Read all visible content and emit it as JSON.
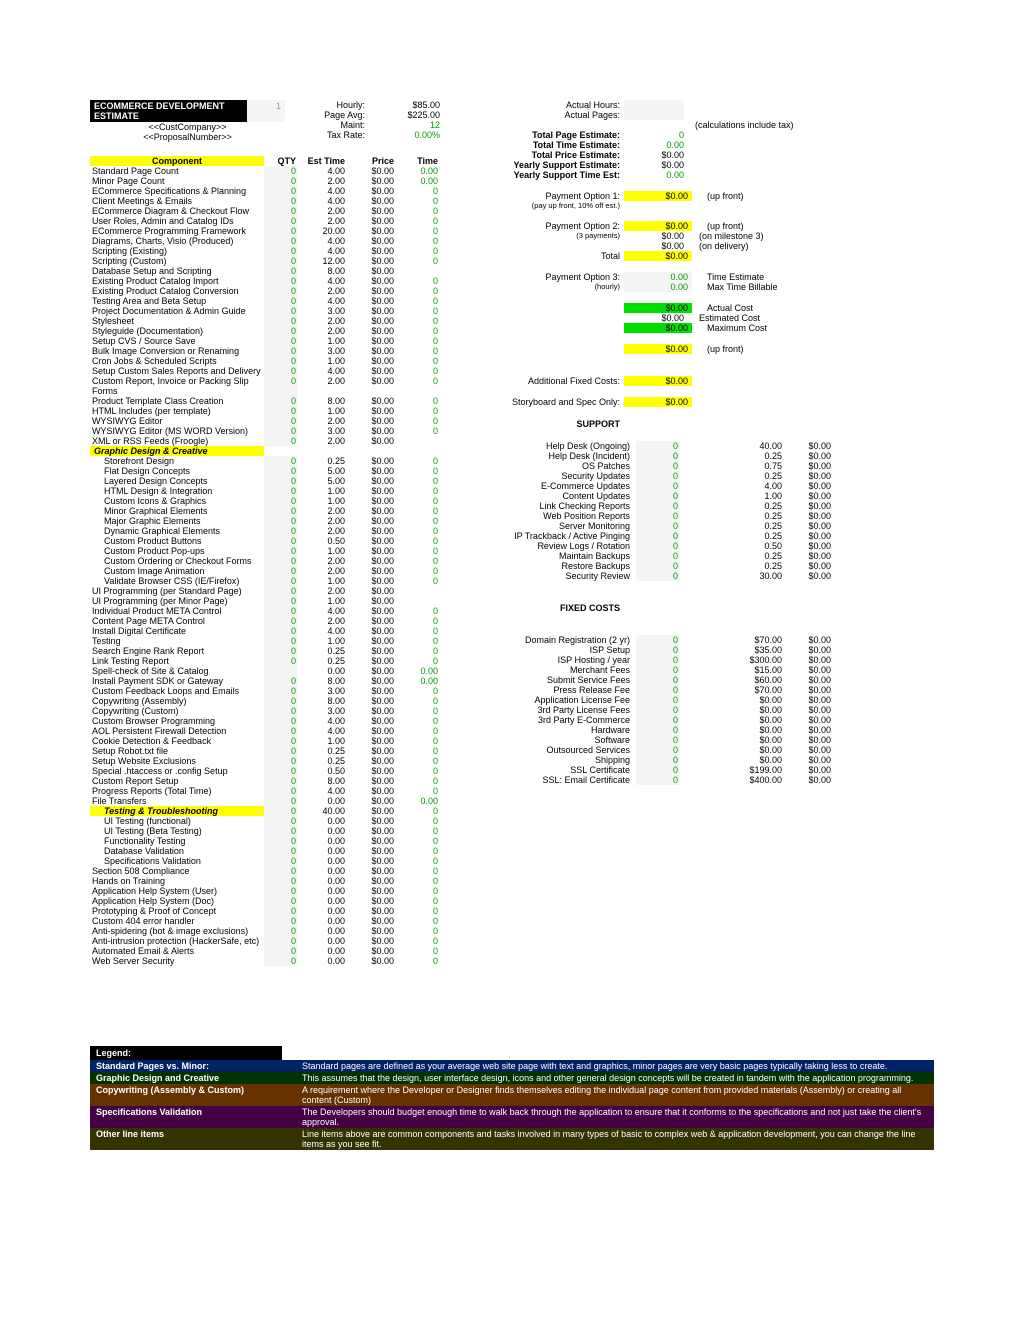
{
  "chart_data": {
    "type": "table",
    "title": "ECOMMERCE DEVELOPMENT ESTIMATE",
    "columns": [
      "Component",
      "QTY",
      "Est Time",
      "Price",
      "Time"
    ]
  },
  "title": "ECOMMERCE DEVELOPMENT ESTIMATE",
  "cust": "<<CustCompany>>",
  "prop": "<<ProposalNumber>>",
  "m": {
    "hourly_l": "Hourly:",
    "hourly_v": "$85.00",
    "pageavg_l": "Page Avg:",
    "pageavg_v": "$225.00",
    "maint_l": "Maint:",
    "maint_v": "12",
    "tax_l": "Tax Rate:",
    "tax_v": "0.00%"
  },
  "h": {
    "comp": "Component",
    "qty": "QTY",
    "est": "Est Time",
    "price": "Price",
    "time": "Time"
  },
  "comp": [
    {
      "l": "Standard Page Count",
      "q": "0",
      "e": "4.00",
      "p": "$0.00",
      "t": "0.00"
    },
    {
      "l": "Minor Page Count",
      "q": "0",
      "e": "2.00",
      "p": "$0.00",
      "t": "0.00"
    },
    {
      "l": "ECommerce Specifications & Planning",
      "q": "0",
      "e": "4.00",
      "p": "$0.00",
      "t": "0",
      "g": 1
    },
    {
      "l": "Client Meetings & Emails",
      "q": "0",
      "e": "4.00",
      "p": "$0.00",
      "t": "0",
      "g": 1
    },
    {
      "l": "ECommerce Diagram & Checkout Flow",
      "q": "0",
      "e": "2.00",
      "p": "$0.00",
      "t": "0",
      "g": 1
    },
    {
      "l": "User Roles, Admin and Catalog IDs",
      "q": "0",
      "e": "2.00",
      "p": "$0.00",
      "t": "0",
      "g": 1
    },
    {
      "l": "ECommerce Programming Framework",
      "q": "0",
      "e": "20.00",
      "p": "$0.00",
      "t": "0",
      "g": 1
    },
    {
      "l": "Diagrams, Charts, Visio (Produced)",
      "q": "0",
      "e": "4.00",
      "p": "$0.00",
      "t": "0",
      "g": 1
    },
    {
      "l": "Scripting (Existing)",
      "q": "0",
      "e": "4.00",
      "p": "$0.00",
      "t": "0",
      "g": 1
    },
    {
      "l": "Scripting (Custom)",
      "q": "0",
      "e": "12.00",
      "p": "$0.00",
      "t": "0",
      "g": 1
    },
    {
      "l": "Database Setup and Scripting",
      "q": "0",
      "e": "8.00",
      "p": "$0.00",
      "t": ""
    },
    {
      "l": "Existing Product Catalog Import",
      "q": "0",
      "e": "4.00",
      "p": "$0.00",
      "t": "0",
      "g": 1
    },
    {
      "l": "Existing Product Catalog Conversion",
      "q": "0",
      "e": "2.00",
      "p": "$0.00",
      "t": "0",
      "g": 1
    },
    {
      "l": "Testing Area and Beta Setup",
      "q": "0",
      "e": "4.00",
      "p": "$0.00",
      "t": "0",
      "g": 1
    },
    {
      "l": "Project Documentation & Admin Guide",
      "q": "0",
      "e": "3.00",
      "p": "$0.00",
      "t": "0",
      "g": 1
    },
    {
      "l": "Stylesheet",
      "q": "0",
      "e": "2.00",
      "p": "$0.00",
      "t": "0",
      "g": 1
    },
    {
      "l": "Styleguide (Documentation)",
      "q": "0",
      "e": "2.00",
      "p": "$0.00",
      "t": "0",
      "g": 1
    },
    {
      "l": "Setup CVS / Source Save",
      "q": "0",
      "e": "1.00",
      "p": "$0.00",
      "t": "0",
      "g": 1
    },
    {
      "l": "Bulk Image Conversion or Renaming",
      "q": "0",
      "e": "3.00",
      "p": "$0.00",
      "t": "0",
      "g": 1
    },
    {
      "l": "Cron Jobs & Scheduled Scripts",
      "q": "0",
      "e": "1.00",
      "p": "$0.00",
      "t": "0",
      "g": 1
    },
    {
      "l": "Setup Custom Sales Reports and Delivery",
      "q": "0",
      "e": "4.00",
      "p": "$0.00",
      "t": "0",
      "g": 1
    },
    {
      "l": "Custom Report, Invoice or Packing Slip Forms",
      "q": "0",
      "e": "2.00",
      "p": "$0.00",
      "t": "0",
      "g": 1
    },
    {
      "l": "Product Template Class Creation",
      "q": "0",
      "e": "8.00",
      "p": "$0.00",
      "t": "0",
      "g": 1
    },
    {
      "l": "HTML Includes (per template)",
      "q": "0",
      "e": "1.00",
      "p": "$0.00",
      "t": "0",
      "g": 1
    },
    {
      "l": "WYSIWYG Editor",
      "q": "0",
      "e": "2.00",
      "p": "$0.00",
      "t": "0",
      "g": 1
    },
    {
      "l": "WYSIWYG Editor (MS WORD Version)",
      "q": "0",
      "e": "3.00",
      "p": "$0.00",
      "t": "0",
      "g": 1
    },
    {
      "l": "XML or RSS Feeds (Froogle)",
      "q": "0",
      "e": "2.00",
      "p": "$0.00",
      "t": ""
    }
  ],
  "gdc": {
    "title": "Graphic Design & Creative",
    "items": [
      {
        "l": "Storefront Design",
        "q": "0",
        "e": "0.25",
        "p": "$0.00",
        "t": "0",
        "g": 1,
        "i": 1
      },
      {
        "l": "Flat Design Concepts",
        "q": "0",
        "e": "5.00",
        "p": "$0.00",
        "t": "0",
        "g": 1,
        "i": 1
      },
      {
        "l": "Layered Design Concepts",
        "q": "0",
        "e": "5.00",
        "p": "$0.00",
        "t": "0",
        "g": 1,
        "i": 1
      },
      {
        "l": "HTML Design & Integration",
        "q": "0",
        "e": "1.00",
        "p": "$0.00",
        "t": "0",
        "g": 1,
        "i": 1
      },
      {
        "l": "Custom Icons & Graphics",
        "q": "0",
        "e": "1.00",
        "p": "$0.00",
        "t": "0",
        "g": 1,
        "i": 1
      },
      {
        "l": "Minor Graphical Elements",
        "q": "0",
        "e": "2.00",
        "p": "$0.00",
        "t": "0",
        "g": 1,
        "i": 1
      },
      {
        "l": "Major Graphic Elements",
        "q": "0",
        "e": "2.00",
        "p": "$0.00",
        "t": "0",
        "g": 1,
        "i": 1
      },
      {
        "l": "Dynamic Graphical Elements",
        "q": "0",
        "e": "2.00",
        "p": "$0.00",
        "t": "0",
        "g": 1,
        "i": 1
      },
      {
        "l": "Custom Product Buttons",
        "q": "0",
        "e": "0.50",
        "p": "$0.00",
        "t": "0",
        "g": 1,
        "i": 1
      },
      {
        "l": "Custom Product Pop-ups",
        "q": "0",
        "e": "1.00",
        "p": "$0.00",
        "t": "0",
        "g": 1,
        "i": 1
      },
      {
        "l": "Custom Ordering or Checkout Forms",
        "q": "0",
        "e": "2.00",
        "p": "$0.00",
        "t": "0",
        "g": 1,
        "i": 1
      },
      {
        "l": "Custom Image Animation",
        "q": "0",
        "e": "2.00",
        "p": "$0.00",
        "t": "0",
        "g": 1,
        "i": 1
      },
      {
        "l": "Validate Browser CSS (IE/Firefox)",
        "q": "0",
        "e": "1.00",
        "p": "$0.00",
        "t": "0",
        "g": 1,
        "i": 1
      }
    ]
  },
  "mid": [
    {
      "l": "UI Programming (per Standard Page)",
      "q": "0",
      "e": "2.00",
      "p": "$0.00",
      "t": ""
    },
    {
      "l": "UI Programming (per Minor Page)",
      "q": "0",
      "e": "1.00",
      "p": "$0.00",
      "t": ""
    },
    {
      "l": "Individual Product META Control",
      "q": "0",
      "e": "4.00",
      "p": "$0.00",
      "t": "0",
      "g": 1
    },
    {
      "l": "Content Page META Control",
      "q": "0",
      "e": "2.00",
      "p": "$0.00",
      "t": "0",
      "g": 1
    },
    {
      "l": "Install Digital Certificate",
      "q": "0",
      "e": "4.00",
      "p": "$0.00",
      "t": "0",
      "g": 1
    },
    {
      "l": "Testing",
      "q": "0",
      "e": "1.00",
      "p": "$0.00",
      "t": "0",
      "g": 1
    },
    {
      "l": "Search Engine Rank Report",
      "q": "0",
      "e": "0.25",
      "p": "$0.00",
      "t": "0",
      "g": 1
    },
    {
      "l": "Link Testing Report",
      "q": "0",
      "e": "0.25",
      "p": "$0.00",
      "t": "0",
      "g": 1
    },
    {
      "l": "Spell-check of Site & Catalog",
      "q": "",
      "e": "0.00",
      "p": "$0.00",
      "t": "0.00"
    },
    {
      "l": "Install Payment SDK or Gateway",
      "q": "0",
      "e": "8.00",
      "p": "$0.00",
      "t": "0.00"
    },
    {
      "l": "Custom Feedback Loops and Emails",
      "q": "0",
      "e": "3.00",
      "p": "$0.00",
      "t": "0",
      "g": 1
    },
    {
      "l": "Copywriting (Assembly)",
      "q": "0",
      "e": "8.00",
      "p": "$0.00",
      "t": "0",
      "g": 1
    },
    {
      "l": "Copywriting (Custom)",
      "q": "0",
      "e": "3.00",
      "p": "$0.00",
      "t": "0",
      "g": 1
    },
    {
      "l": "Custom Browser Programming",
      "q": "0",
      "e": "4.00",
      "p": "$0.00",
      "t": "0",
      "g": 1
    },
    {
      "l": "AOL Persistent Firewall Detection",
      "q": "0",
      "e": "4.00",
      "p": "$0.00",
      "t": "0",
      "g": 1
    },
    {
      "l": "Cookie Detection & Feedback",
      "q": "0",
      "e": "1.00",
      "p": "$0.00",
      "t": "0",
      "g": 1
    },
    {
      "l": "Setup Robot.txt file",
      "q": "0",
      "e": "0.25",
      "p": "$0.00",
      "t": "0",
      "g": 1
    },
    {
      "l": "Setup Website Exclusions",
      "q": "0",
      "e": "0.25",
      "p": "$0.00",
      "t": "0",
      "g": 1
    },
    {
      "l": "Special .htaccess or .config Setup",
      "q": "0",
      "e": "0.50",
      "p": "$0.00",
      "t": "0",
      "g": 1
    },
    {
      "l": "Custom Report Setup",
      "q": "0",
      "e": "8.00",
      "p": "$0.00",
      "t": "0",
      "g": 1
    },
    {
      "l": "Progress Reports (Total Time)",
      "q": "0",
      "e": "4.00",
      "p": "$0.00",
      "t": "0",
      "g": 1
    },
    {
      "l": "File Transfers",
      "q": "0",
      "e": "0.00",
      "p": "$0.00",
      "t": "0.00"
    }
  ],
  "tt": {
    "title": "Testing & Troubleshooting",
    "q": "0",
    "e": "40.00",
    "p": "$0.00",
    "t": "0",
    "items": [
      {
        "l": "UI Testing (functional)",
        "q": "0",
        "e": "0.00",
        "p": "$0.00",
        "t": "0",
        "g": 1,
        "i": 1
      },
      {
        "l": "UI Testing (Beta Testing)",
        "q": "0",
        "e": "0.00",
        "p": "$0.00",
        "t": "0",
        "g": 1,
        "i": 1
      },
      {
        "l": "Functionality Testing",
        "q": "0",
        "e": "0.00",
        "p": "$0.00",
        "t": "0",
        "g": 1,
        "i": 1
      },
      {
        "l": "Database Validation",
        "q": "0",
        "e": "0.00",
        "p": "$0.00",
        "t": "0",
        "g": 1,
        "i": 1
      },
      {
        "l": "Specifications Validation",
        "q": "0",
        "e": "0.00",
        "p": "$0.00",
        "t": "0",
        "g": 1,
        "i": 1
      }
    ]
  },
  "end": [
    {
      "l": "Section 508 Compliance",
      "q": "0",
      "e": "0.00",
      "p": "$0.00",
      "t": "0",
      "g": 1
    },
    {
      "l": "Hands on Training",
      "q": "0",
      "e": "0.00",
      "p": "$0.00",
      "t": "0",
      "g": 1
    },
    {
      "l": "Application Help System (User)",
      "q": "0",
      "e": "0.00",
      "p": "$0.00",
      "t": "0",
      "g": 1
    },
    {
      "l": "Application Help System (Doc)",
      "q": "0",
      "e": "0.00",
      "p": "$0.00",
      "t": "0",
      "g": 1
    },
    {
      "l": "Prototyping & Proof of Concept",
      "q": "0",
      "e": "0.00",
      "p": "$0.00",
      "t": "0",
      "g": 1
    },
    {
      "l": "Custom 404 error handler",
      "q": "0",
      "e": "0.00",
      "p": "$0.00",
      "t": "0",
      "g": 1
    },
    {
      "l": "Anti-spidering (bot & image exclusions)",
      "q": "0",
      "e": "0.00",
      "p": "$0.00",
      "t": "0",
      "g": 1
    },
    {
      "l": "Anti-intrusion protection (HackerSafe, etc)",
      "q": "0",
      "e": "0.00",
      "p": "$0.00",
      "t": "0",
      "g": 1
    },
    {
      "l": "Automated Email & Alerts",
      "q": "0",
      "e": "0.00",
      "p": "$0.00",
      "t": "0",
      "g": 1
    },
    {
      "l": "Web Server Security",
      "q": "0",
      "e": "0.00",
      "p": "$0.00",
      "t": "0",
      "g": 1
    }
  ],
  "R": {
    "actH": "Actual Hours:",
    "actP": "Actual Pages:",
    "calc": "(calculations include tax)",
    "tpe": "Total Page Estimate:",
    "tpe_v": "0",
    "tte": "Total Time Estimate:",
    "tte_v": "0.00",
    "tpr": "Total Price Estimate:",
    "tpr_v": "$0.00",
    "yse": "Yearly Support Estimate:",
    "yse_v": "$0.00",
    "yst": "Yearly Support Time Est:",
    "yst_v": "0.00",
    "po1": "Payment Option 1:",
    "po1_v": "$0.00",
    "po1_n": "(up front)",
    "po1_d": "(pay up front, 10% off est.)",
    "po2": "Payment Option 2:",
    "po2_v": "$0.00",
    "po2_n": "(up front)",
    "po2_d": "(3 payments)",
    "po2_v2": "$0.00",
    "po2_n2": "(on milestone 3)",
    "po2_v3": "$0.00",
    "po2_n3": "(on delivery)",
    "tot": "Total",
    "tot_v": "$0.00",
    "po3": "Payment Option 3:",
    "po3_v": "0.00",
    "po3_n": "Time Estimate",
    "po3_d": "(hourly)",
    "po3_v2": "0.00",
    "po3_n2": "Max Time Billable",
    "ac": "Actual Cost",
    "ac_v": "$0.00",
    "ec": "Estimated Cost",
    "ec_v": "$0.00",
    "mc": "Maximum Cost",
    "mc_v": "$0.00",
    "dep": "$0.00",
    "dep_n": "(up front)",
    "afc": "Additional Fixed Costs:",
    "afc_v": "$0.00",
    "sbs": "Storyboard and Spec Only:",
    "sbs_v": "$0.00",
    "sup": "SUPPORT",
    "fc": "FIXED COSTS"
  },
  "support": [
    {
      "l": "Help Desk (Ongoing)",
      "q": "0",
      "e": "40.00",
      "p": "$0.00"
    },
    {
      "l": "Help Desk (Incident)",
      "q": "0",
      "e": "0.25",
      "p": "$0.00"
    },
    {
      "l": "OS Patches",
      "q": "0",
      "e": "0.75",
      "p": "$0.00"
    },
    {
      "l": "Security Updates",
      "q": "0",
      "e": "0.25",
      "p": "$0.00"
    },
    {
      "l": "E-Commerce Updates",
      "q": "0",
      "e": "4.00",
      "p": "$0.00"
    },
    {
      "l": "Content Updates",
      "q": "0",
      "e": "1.00",
      "p": "$0.00"
    },
    {
      "l": "Link Checking Reports",
      "q": "0",
      "e": "0.25",
      "p": "$0.00"
    },
    {
      "l": "Web Position Reports",
      "q": "0",
      "e": "0.25",
      "p": "$0.00"
    },
    {
      "l": "Server Monitoring",
      "q": "0",
      "e": "0.25",
      "p": "$0.00"
    },
    {
      "l": "IP Trackback / Active Pinging",
      "q": "0",
      "e": "0.25",
      "p": "$0.00"
    },
    {
      "l": "Review Logs / Rotation",
      "q": "0",
      "e": "0.50",
      "p": "$0.00"
    },
    {
      "l": "Maintain Backups",
      "q": "0",
      "e": "0.25",
      "p": "$0.00"
    },
    {
      "l": "Restore Backups",
      "q": "0",
      "e": "0.25",
      "p": "$0.00"
    },
    {
      "l": "Security Review",
      "q": "0",
      "e": "30.00",
      "p": "$0.00"
    }
  ],
  "fixed": [
    {
      "l": "Domain Registration (2 yr)",
      "q": "0",
      "e": "$70.00",
      "p": "$0.00"
    },
    {
      "l": "ISP Setup",
      "q": "0",
      "e": "$35.00",
      "p": "$0.00"
    },
    {
      "l": "ISP Hosting / year",
      "q": "0",
      "e": "$300.00",
      "p": "$0.00"
    },
    {
      "l": "Merchant Fees",
      "q": "0",
      "e": "$15.00",
      "p": "$0.00"
    },
    {
      "l": "Submit Service Fees",
      "q": "0",
      "e": "$60.00",
      "p": "$0.00"
    },
    {
      "l": "Press Release Fee",
      "q": "0",
      "e": "$70.00",
      "p": "$0.00"
    },
    {
      "l": "Application License Fee",
      "q": "0",
      "e": "$0.00",
      "p": "$0.00"
    },
    {
      "l": "3rd Party License Fees",
      "q": "0",
      "e": "$0.00",
      "p": "$0.00"
    },
    {
      "l": "3rd Party E-Commerce",
      "q": "0",
      "e": "$0.00",
      "p": "$0.00"
    },
    {
      "l": "Hardware",
      "q": "0",
      "e": "$0.00",
      "p": "$0.00"
    },
    {
      "l": "Software",
      "q": "0",
      "e": "$0.00",
      "p": "$0.00"
    },
    {
      "l": "Outsourced Services",
      "q": "0",
      "e": "$0.00",
      "p": "$0.00"
    },
    {
      "l": "Shipping",
      "q": "0",
      "e": "$0.00",
      "p": "$0.00"
    },
    {
      "l": "SSL Certificate",
      "q": "0",
      "e": "$199.00",
      "p": "$0.00"
    },
    {
      "l": "SSL: Email Certificate",
      "q": "0",
      "e": "$400.00",
      "p": "$0.00"
    }
  ],
  "legend": {
    "title": "Legend:",
    "rows": [
      {
        "k": "Standard Pages vs. Minor:",
        "t": "Standard pages are defined as your average web site page with text and graphics, minor pages are very basic pages typically taking less to create.",
        "c": "l1"
      },
      {
        "k": "Graphic Design and Creative",
        "t": "This assumes that the design, user interface design, icons and other general design concepts will be created in tandem with the application programming.",
        "c": "l2"
      },
      {
        "k": "Copywriting (Assembly & Custom)",
        "t": "A requirement where the Developer or Designer finds themselves editing the individual page content from provided materials (Assembly) or creating all content (Custom)",
        "c": "l3"
      },
      {
        "k": "Specifications Validation",
        "t": "The Developers should budget enough time to walk back through the application to ensure that it conforms to the specifications and not just take the client's approval.",
        "c": "l4"
      },
      {
        "k": "Other line items",
        "t": "Line items above are common components and tasks involved in many types of basic to complex web & application development, you can change the line items as you see fit.",
        "c": "l5"
      }
    ]
  }
}
